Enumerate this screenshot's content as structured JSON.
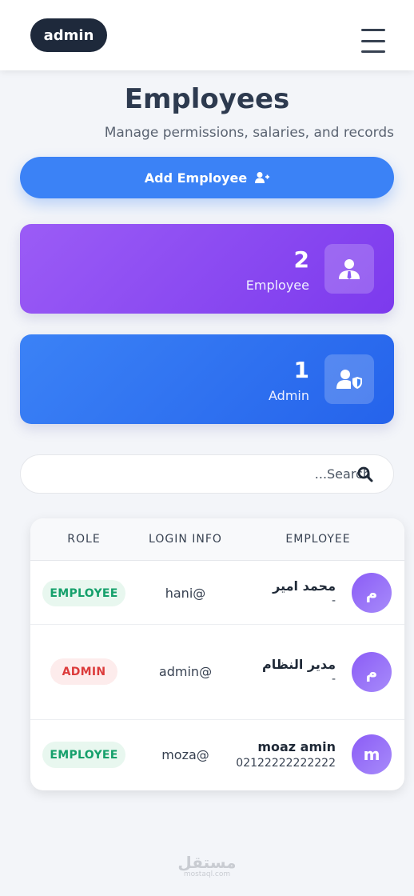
{
  "header": {
    "user_label": "admin",
    "menu_icon": "hamburger-icon"
  },
  "page": {
    "title": "Employees",
    "subtitle": "Manage permissions, salaries, and records"
  },
  "add_button": {
    "label": "Add Employee",
    "icon": "user-plus-icon",
    "color": "#3b82f6"
  },
  "stats": [
    {
      "count": "2",
      "label": "Employee",
      "icon": "user-tie-icon",
      "color": "#8b5cf6"
    },
    {
      "count": "1",
      "label": "Admin",
      "icon": "user-shield-icon",
      "color": "#3b82f6"
    }
  ],
  "search": {
    "placeholder": "...Search",
    "icon": "search-icon"
  },
  "table": {
    "columns": {
      "role": "ROLE",
      "login": "LOGIN INFO",
      "employee": "EMPLOYEE"
    },
    "rows": [
      {
        "initial": "م",
        "name": "محمد امير",
        "phone": "-",
        "login": "hani@",
        "role": "EMPLOYEE"
      },
      {
        "initial": "م",
        "name": "مدير النظام",
        "phone": "-",
        "login": "admin@",
        "role": "ADMIN"
      },
      {
        "initial": "m",
        "name": "moaz amin",
        "phone": "02122222222222",
        "login": "moza@",
        "role": "EMPLOYEE"
      }
    ]
  },
  "watermark": {
    "main": "مستقل",
    "sub": "mostaql.com"
  }
}
